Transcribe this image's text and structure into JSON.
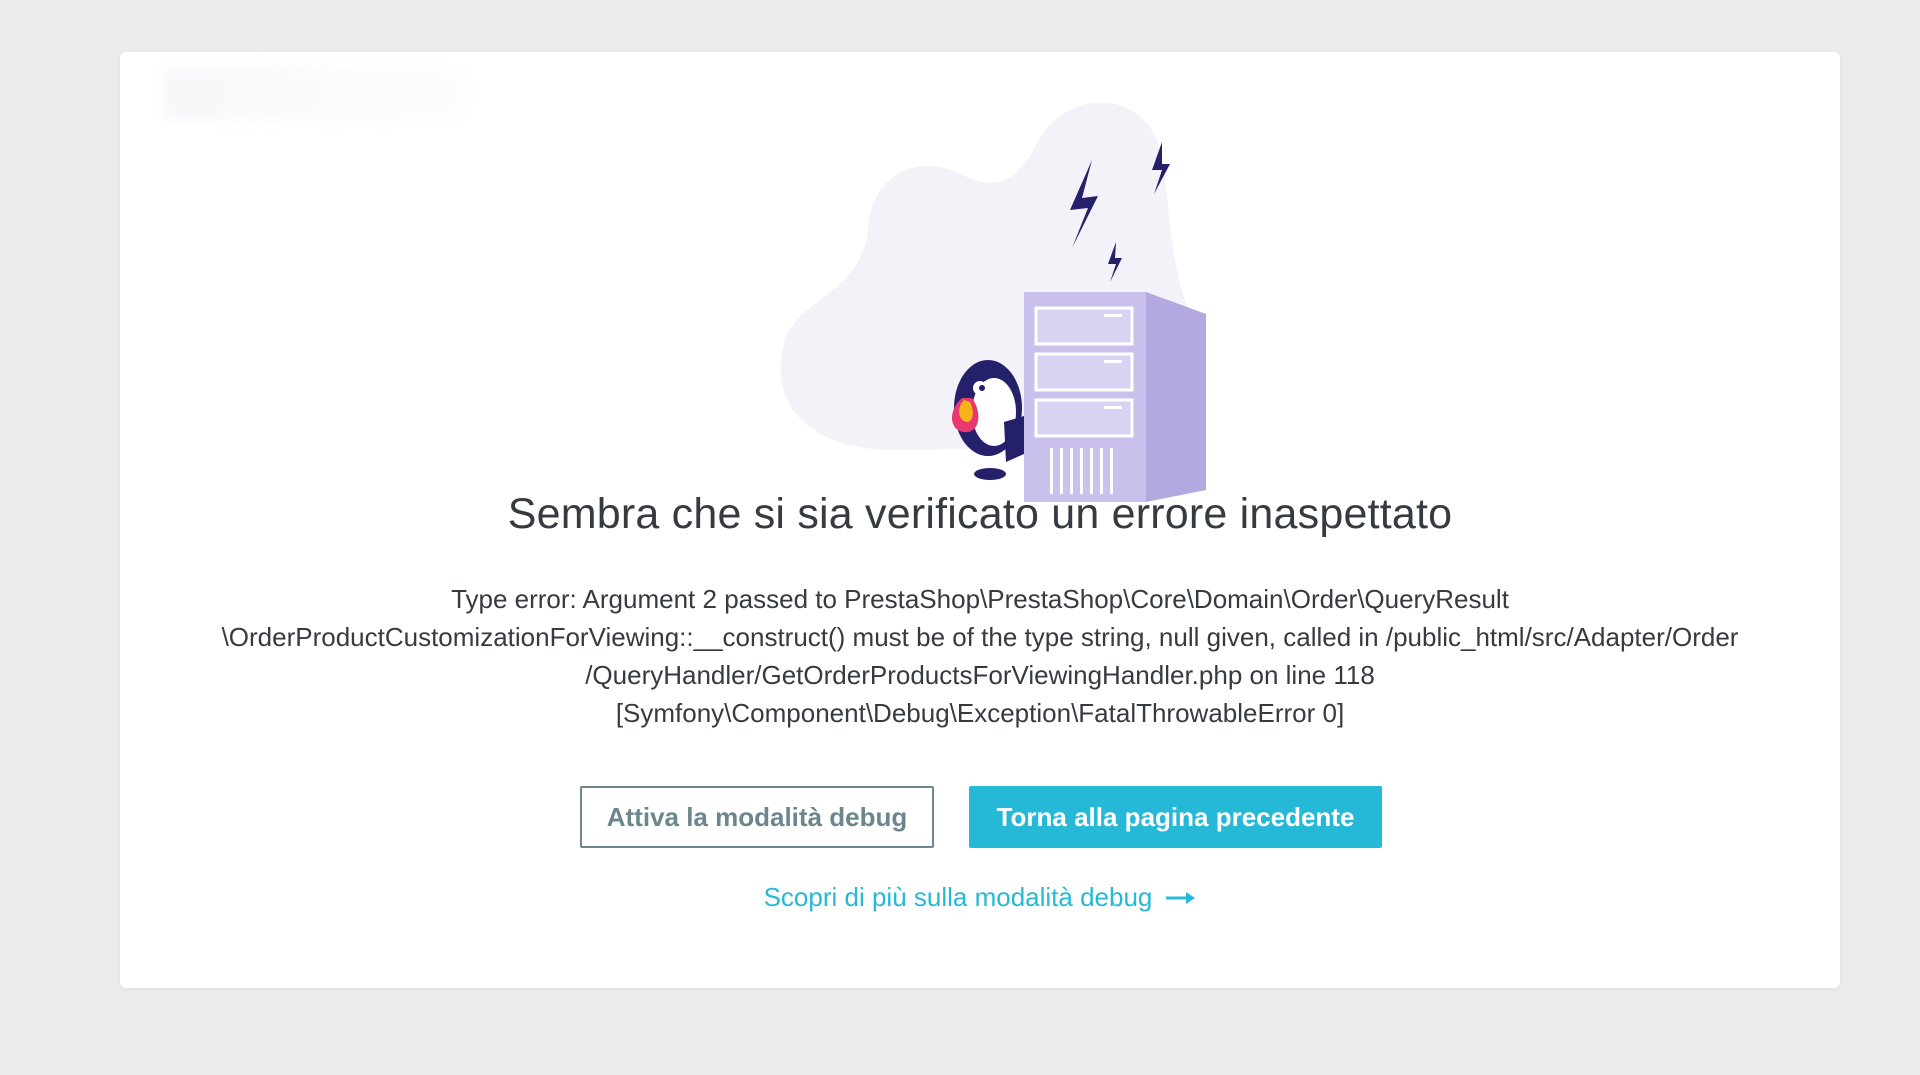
{
  "page": {
    "title": "Sembra che si sia verificato un errore inaspettato",
    "error_lines": [
      "Type error: Argument 2 passed to PrestaShop\\PrestaShop\\Core\\Domain\\Order\\QueryResult",
      "\\OrderProductCustomizationForViewing::__construct() must be of the type string, null given, called in /public_html/src/Adapter/Order",
      "/QueryHandler/GetOrderProductsForViewingHandler.php on line 118",
      "[Symfony\\Component\\Debug\\Exception\\FatalThrowableError 0]"
    ]
  },
  "actions": {
    "debug_button_label": "Attiva la modalità debug",
    "back_button_label": "Torna alla pagina precedente",
    "learn_more_label": "Scopri di più sulla modalità debug"
  },
  "icons": {
    "illustration": "server-error-puffin-illustration",
    "learn_more_icon": "arrow-right-icon"
  },
  "colors": {
    "background": "#eaebed",
    "card": "#ffffff",
    "text": "#363a41",
    "primary": "#25b9d7",
    "outline": "#6c868e",
    "server": "#c5bde8",
    "bolt": "#25206a"
  }
}
